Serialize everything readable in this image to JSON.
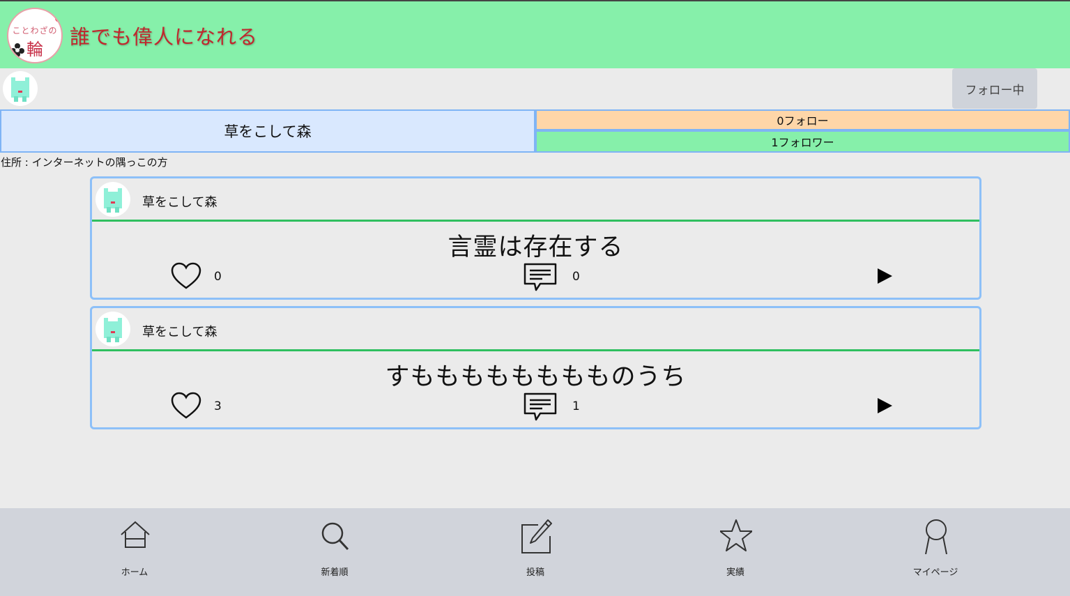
{
  "header": {
    "logo_top": "ことわざの",
    "logo_main": "輪",
    "site_title": "誰でも偉人になれる"
  },
  "profile": {
    "name": "草をこして森",
    "follow_button": "フォロー中",
    "follow_count": "0フォロー",
    "follower_count": "1フォロワー",
    "address": "住所 : インターネットの隅っこの方"
  },
  "posts": [
    {
      "author": "草をこして森",
      "title": "言霊は存在する",
      "likes": "0",
      "comments": "0"
    },
    {
      "author": "草をこして森",
      "title": "すもももももももものうち",
      "likes": "3",
      "comments": "1"
    }
  ],
  "nav": [
    {
      "label": "ホーム",
      "icon": "home-icon"
    },
    {
      "label": "新着順",
      "icon": "search-icon"
    },
    {
      "label": "投稿",
      "icon": "edit-icon"
    },
    {
      "label": "実績",
      "icon": "star-icon"
    },
    {
      "label": "マイページ",
      "icon": "person-icon"
    }
  ],
  "colors": {
    "header_bg": "#86f0aa",
    "title_red": "#c0282e",
    "name_bg": "#d9e8fe",
    "follow_bg": "#fed6a8",
    "card_border": "#8dc0f8",
    "card_divider": "#2fbf5f",
    "nav_bg": "#d1d4db"
  }
}
